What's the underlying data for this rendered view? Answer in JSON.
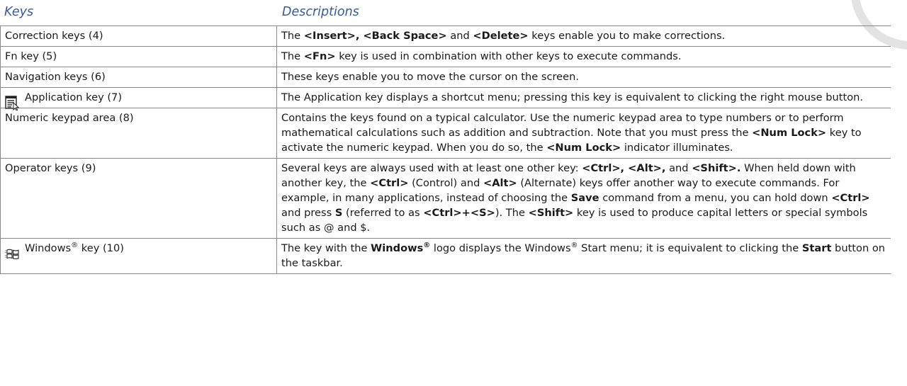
{
  "headers": {
    "keys": "Keys",
    "descriptions": "Descriptions"
  },
  "rows": [
    {
      "key": "Correction keys (4)",
      "desc": [
        {
          "t": "The "
        },
        {
          "t": "<Insert>, <Back Space>",
          "b": true
        },
        {
          "t": " and "
        },
        {
          "t": "<Delete>",
          "b": true
        },
        {
          "t": " keys enable you to make corrections."
        }
      ]
    },
    {
      "key": "Fn key (5)",
      "desc": [
        {
          "t": "The "
        },
        {
          "t": "<Fn>",
          "b": true
        },
        {
          "t": " key is used in combination with other keys to execute commands."
        }
      ]
    },
    {
      "key": "Navigation keys (6)",
      "desc": [
        {
          "t": "These keys enable you to move the cursor on the screen."
        }
      ]
    },
    {
      "key": "Application key (7)",
      "icon": "application-key-icon",
      "desc": [
        {
          "t": "The Application key displays a shortcut menu; pressing this key is equivalent to clicking the right mouse button."
        }
      ]
    },
    {
      "key": "Numeric keypad area (8)",
      "desc": [
        {
          "t": "Contains the keys found on a typical calculator. Use the numeric keypad area to type numbers or to perform mathematical calculations such as addition and subtraction. Note that you must press the "
        },
        {
          "t": "<Num Lock>",
          "b": true
        },
        {
          "t": " key to activate the numeric keypad. When you do so, the "
        },
        {
          "t": "<Num Lock>",
          "b": true
        },
        {
          "t": " indicator illuminates."
        }
      ]
    },
    {
      "key": "Operator keys (9)",
      "desc": [
        {
          "t": "Several keys are always used with at least one other key:  "
        },
        {
          "t": "<Ctrl>, <Alt>,",
          "b": true
        },
        {
          "t": " and "
        },
        {
          "t": "<Shift>.",
          "b": true
        },
        {
          "t": " When held down with another key, the "
        },
        {
          "t": "<Ctrl>",
          "b": true
        },
        {
          "t": " (Control) and "
        },
        {
          "t": "<Alt>",
          "b": true
        },
        {
          "t": " (Alternate) keys offer another way to execute commands. For example, in many applications, instead of choosing the "
        },
        {
          "t": "Save",
          "b": true
        },
        {
          "t": " command from a menu, you can hold down "
        },
        {
          "t": "<Ctrl>",
          "b": true
        },
        {
          "t": " and press "
        },
        {
          "t": "S",
          "b": true
        },
        {
          "t": " (referred to as "
        },
        {
          "t": "<Ctrl>+<S>",
          "b": true
        },
        {
          "t": "). The "
        },
        {
          "t": "<Shift>",
          "b": true
        },
        {
          "t": " key is used to produce capital letters or special symbols such as @ and $."
        }
      ]
    },
    {
      "key": "Windows",
      "key_sup": "®",
      "key_suffix": " key (10)",
      "icon": "windows-logo-icon",
      "desc": [
        {
          "t": "The key with the "
        },
        {
          "t": "Windows",
          "b": true
        },
        {
          "t": "®",
          "b": true,
          "sup": true
        },
        {
          "t": " logo displays the Windows"
        },
        {
          "t": "®",
          "sup": true
        },
        {
          "t": " Start menu; it is equivalent to clicking the "
        },
        {
          "t": "Start",
          "b": true
        },
        {
          "t": " button on the taskbar."
        }
      ]
    }
  ]
}
